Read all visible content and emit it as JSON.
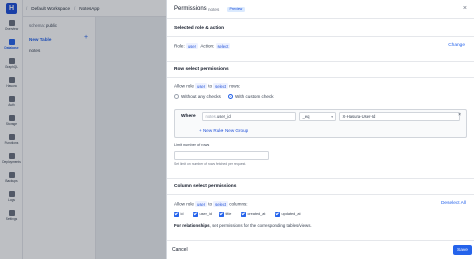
{
  "nav": {
    "logo": "H",
    "items": [
      {
        "label": "Overview"
      },
      {
        "label": "Database"
      },
      {
        "label": "GraphQL"
      },
      {
        "label": "Hasura"
      },
      {
        "label": "Auth"
      },
      {
        "label": "Storage"
      },
      {
        "label": "Functions"
      },
      {
        "label": "Deployments"
      },
      {
        "label": "Backups"
      },
      {
        "label": "Logs"
      },
      {
        "label": "Settings"
      }
    ]
  },
  "breadcrumb": {
    "workspace": "Default Workspace",
    "project": "NotesApp"
  },
  "sidebar": {
    "schema_label": "schema",
    "schema_value": "public",
    "new_table": "New Table",
    "tables": [
      "notes"
    ]
  },
  "panel": {
    "title": "Permissions",
    "table": "notes",
    "badge": "Preview",
    "close": "×",
    "selected": {
      "title": "Selected role & action",
      "role_label": "Role:",
      "role": "user",
      "action_label": "Action:",
      "action": "select",
      "change": "Change"
    },
    "row": {
      "title": "Row select permissions",
      "allow_pre": "Allow role",
      "role": "user",
      "to": "to",
      "action": "select",
      "allow_post": "rows:",
      "opt_without": "Without any checks",
      "opt_custom": "With custom check",
      "where": "Where",
      "column_prefix": "notes.",
      "column": "user_id",
      "operator": "_eq",
      "value": "X-Hasura-User-Id",
      "new_rule": "+ New Rule",
      "new_group": "+ New Group",
      "limit_label": "Limit number of rows",
      "limit_hint": "Set limit on number of rows fetched per request."
    },
    "columns": {
      "title": "Column select permissions",
      "allow_pre": "Allow role",
      "role": "user",
      "to": "to",
      "action": "select",
      "allow_post": "columns:",
      "deselect_all": "Deselect All",
      "items": [
        "id",
        "user_id",
        "title",
        "created_at",
        "updated_at"
      ],
      "rel_bold": "For relationships",
      "rel_rest": ", set permissions for the corresponding tables/views."
    },
    "footer": {
      "cancel": "Cancel",
      "save": "Save"
    }
  }
}
